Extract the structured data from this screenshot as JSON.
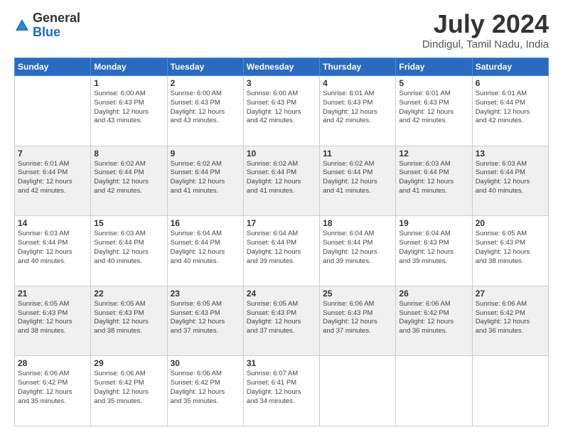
{
  "header": {
    "logo_general": "General",
    "logo_blue": "Blue",
    "month_title": "July 2024",
    "location": "Dindigul, Tamil Nadu, India"
  },
  "calendar": {
    "days": [
      "Sunday",
      "Monday",
      "Tuesday",
      "Wednesday",
      "Thursday",
      "Friday",
      "Saturday"
    ],
    "weeks": [
      [
        {
          "day": "",
          "sunrise": "",
          "sunset": "",
          "daylight": ""
        },
        {
          "day": "1",
          "sunrise": "Sunrise: 6:00 AM",
          "sunset": "Sunset: 6:43 PM",
          "daylight": "Daylight: 12 hours and 43 minutes."
        },
        {
          "day": "2",
          "sunrise": "Sunrise: 6:00 AM",
          "sunset": "Sunset: 6:43 PM",
          "daylight": "Daylight: 12 hours and 43 minutes."
        },
        {
          "day": "3",
          "sunrise": "Sunrise: 6:00 AM",
          "sunset": "Sunset: 6:43 PM",
          "daylight": "Daylight: 12 hours and 42 minutes."
        },
        {
          "day": "4",
          "sunrise": "Sunrise: 6:01 AM",
          "sunset": "Sunset: 6:43 PM",
          "daylight": "Daylight: 12 hours and 42 minutes."
        },
        {
          "day": "5",
          "sunrise": "Sunrise: 6:01 AM",
          "sunset": "Sunset: 6:43 PM",
          "daylight": "Daylight: 12 hours and 42 minutes."
        },
        {
          "day": "6",
          "sunrise": "Sunrise: 6:01 AM",
          "sunset": "Sunset: 6:44 PM",
          "daylight": "Daylight: 12 hours and 42 minutes."
        }
      ],
      [
        {
          "day": "7",
          "sunrise": "Sunrise: 6:01 AM",
          "sunset": "Sunset: 6:44 PM",
          "daylight": "Daylight: 12 hours and 42 minutes."
        },
        {
          "day": "8",
          "sunrise": "Sunrise: 6:02 AM",
          "sunset": "Sunset: 6:44 PM",
          "daylight": "Daylight: 12 hours and 42 minutes."
        },
        {
          "day": "9",
          "sunrise": "Sunrise: 6:02 AM",
          "sunset": "Sunset: 6:44 PM",
          "daylight": "Daylight: 12 hours and 41 minutes."
        },
        {
          "day": "10",
          "sunrise": "Sunrise: 6:02 AM",
          "sunset": "Sunset: 6:44 PM",
          "daylight": "Daylight: 12 hours and 41 minutes."
        },
        {
          "day": "11",
          "sunrise": "Sunrise: 6:02 AM",
          "sunset": "Sunset: 6:44 PM",
          "daylight": "Daylight: 12 hours and 41 minutes."
        },
        {
          "day": "12",
          "sunrise": "Sunrise: 6:03 AM",
          "sunset": "Sunset: 6:44 PM",
          "daylight": "Daylight: 12 hours and 41 minutes."
        },
        {
          "day": "13",
          "sunrise": "Sunrise: 6:03 AM",
          "sunset": "Sunset: 6:44 PM",
          "daylight": "Daylight: 12 hours and 40 minutes."
        }
      ],
      [
        {
          "day": "14",
          "sunrise": "Sunrise: 6:03 AM",
          "sunset": "Sunset: 6:44 PM",
          "daylight": "Daylight: 12 hours and 40 minutes."
        },
        {
          "day": "15",
          "sunrise": "Sunrise: 6:03 AM",
          "sunset": "Sunset: 6:44 PM",
          "daylight": "Daylight: 12 hours and 40 minutes."
        },
        {
          "day": "16",
          "sunrise": "Sunrise: 6:04 AM",
          "sunset": "Sunset: 6:44 PM",
          "daylight": "Daylight: 12 hours and 40 minutes."
        },
        {
          "day": "17",
          "sunrise": "Sunrise: 6:04 AM",
          "sunset": "Sunset: 6:44 PM",
          "daylight": "Daylight: 12 hours and 39 minutes."
        },
        {
          "day": "18",
          "sunrise": "Sunrise: 6:04 AM",
          "sunset": "Sunset: 6:44 PM",
          "daylight": "Daylight: 12 hours and 39 minutes."
        },
        {
          "day": "19",
          "sunrise": "Sunrise: 6:04 AM",
          "sunset": "Sunset: 6:43 PM",
          "daylight": "Daylight: 12 hours and 39 minutes."
        },
        {
          "day": "20",
          "sunrise": "Sunrise: 6:05 AM",
          "sunset": "Sunset: 6:43 PM",
          "daylight": "Daylight: 12 hours and 38 minutes."
        }
      ],
      [
        {
          "day": "21",
          "sunrise": "Sunrise: 6:05 AM",
          "sunset": "Sunset: 6:43 PM",
          "daylight": "Daylight: 12 hours and 38 minutes."
        },
        {
          "day": "22",
          "sunrise": "Sunrise: 6:05 AM",
          "sunset": "Sunset: 6:43 PM",
          "daylight": "Daylight: 12 hours and 38 minutes."
        },
        {
          "day": "23",
          "sunrise": "Sunrise: 6:05 AM",
          "sunset": "Sunset: 6:43 PM",
          "daylight": "Daylight: 12 hours and 37 minutes."
        },
        {
          "day": "24",
          "sunrise": "Sunrise: 6:05 AM",
          "sunset": "Sunset: 6:43 PM",
          "daylight": "Daylight: 12 hours and 37 minutes."
        },
        {
          "day": "25",
          "sunrise": "Sunrise: 6:06 AM",
          "sunset": "Sunset: 6:43 PM",
          "daylight": "Daylight: 12 hours and 37 minutes."
        },
        {
          "day": "26",
          "sunrise": "Sunrise: 6:06 AM",
          "sunset": "Sunset: 6:42 PM",
          "daylight": "Daylight: 12 hours and 36 minutes."
        },
        {
          "day": "27",
          "sunrise": "Sunrise: 6:06 AM",
          "sunset": "Sunset: 6:42 PM",
          "daylight": "Daylight: 12 hours and 36 minutes."
        }
      ],
      [
        {
          "day": "28",
          "sunrise": "Sunrise: 6:06 AM",
          "sunset": "Sunset: 6:42 PM",
          "daylight": "Daylight: 12 hours and 35 minutes."
        },
        {
          "day": "29",
          "sunrise": "Sunrise: 6:06 AM",
          "sunset": "Sunset: 6:42 PM",
          "daylight": "Daylight: 12 hours and 35 minutes."
        },
        {
          "day": "30",
          "sunrise": "Sunrise: 6:06 AM",
          "sunset": "Sunset: 6:42 PM",
          "daylight": "Daylight: 12 hours and 35 minutes."
        },
        {
          "day": "31",
          "sunrise": "Sunrise: 6:07 AM",
          "sunset": "Sunset: 6:41 PM",
          "daylight": "Daylight: 12 hours and 34 minutes."
        },
        {
          "day": "",
          "sunrise": "",
          "sunset": "",
          "daylight": ""
        },
        {
          "day": "",
          "sunrise": "",
          "sunset": "",
          "daylight": ""
        },
        {
          "day": "",
          "sunrise": "",
          "sunset": "",
          "daylight": ""
        }
      ]
    ]
  }
}
